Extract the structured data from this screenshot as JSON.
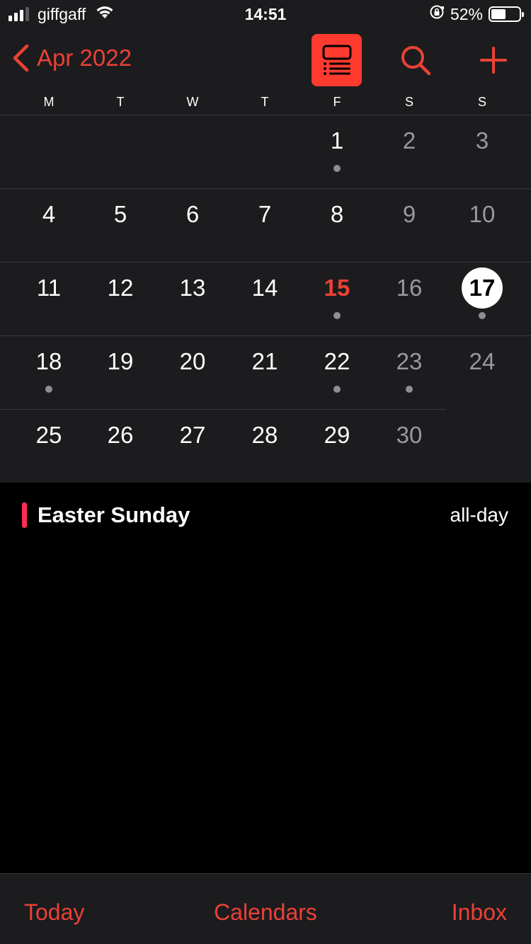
{
  "status_bar": {
    "carrier": "giffgaff",
    "time": "14:51",
    "battery_percent_text": "52%",
    "battery_level": 0.52,
    "signal_bars_active": 3,
    "signal_bars_total": 4
  },
  "nav": {
    "back_label": "Apr 2022",
    "accent_color": "#eb4136"
  },
  "weekdays": [
    "M",
    "T",
    "W",
    "T",
    "F",
    "S",
    "S"
  ],
  "calendar": {
    "weeks": [
      [
        null,
        null,
        null,
        null,
        {
          "n": "1",
          "dot": true
        },
        {
          "n": "2"
        },
        {
          "n": "3"
        }
      ],
      [
        {
          "n": "4"
        },
        {
          "n": "5"
        },
        {
          "n": "6"
        },
        {
          "n": "7"
        },
        {
          "n": "8"
        },
        {
          "n": "9"
        },
        {
          "n": "10"
        }
      ],
      [
        {
          "n": "11"
        },
        {
          "n": "12"
        },
        {
          "n": "13"
        },
        {
          "n": "14"
        },
        {
          "n": "15",
          "today": true,
          "dot": true
        },
        {
          "n": "16"
        },
        {
          "n": "17",
          "selected": true,
          "dot": true
        }
      ],
      [
        {
          "n": "18",
          "dot": true
        },
        {
          "n": "19"
        },
        {
          "n": "20"
        },
        {
          "n": "21"
        },
        {
          "n": "22",
          "dot": true
        },
        {
          "n": "23",
          "dot": true
        },
        {
          "n": "24"
        }
      ],
      [
        {
          "n": "25"
        },
        {
          "n": "26"
        },
        {
          "n": "27"
        },
        {
          "n": "28"
        },
        {
          "n": "29"
        },
        {
          "n": "30"
        },
        null
      ]
    ]
  },
  "events": [
    {
      "title": "Easter Sunday",
      "time": "all-day",
      "color": "#ff2d55"
    }
  ],
  "tabbar": {
    "today": "Today",
    "calendars": "Calendars",
    "inbox": "Inbox"
  }
}
